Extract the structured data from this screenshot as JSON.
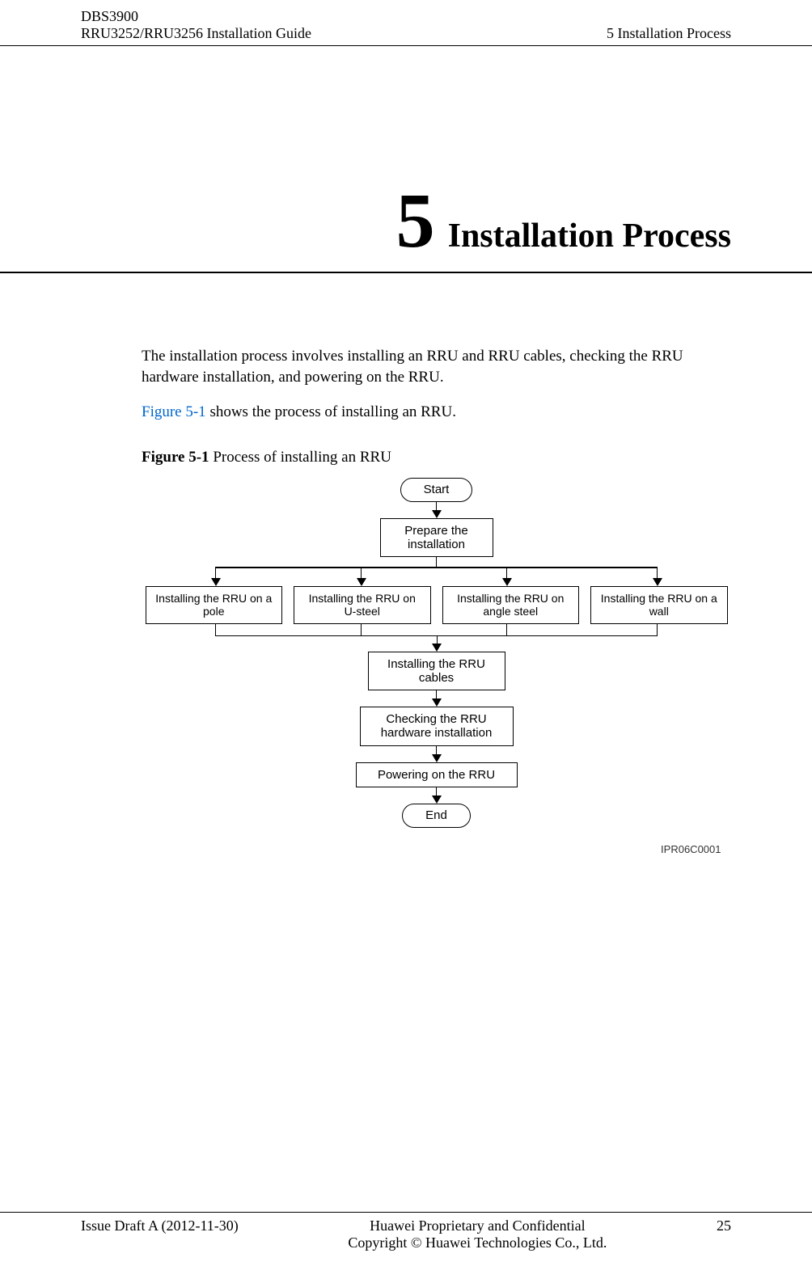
{
  "header": {
    "product": "DBS3900",
    "doc_title": "RRU3252/RRU3256 Installation Guide",
    "section": "5 Installation Process"
  },
  "chapter": {
    "number": "5",
    "title": "Installation Process"
  },
  "body": {
    "intro": "The installation process involves installing an RRU and RRU cables, checking the RRU hardware installation, and powering on the RRU.",
    "figref_link": "Figure 5-1",
    "figref_rest": " shows the process of installing an RRU.",
    "fig_label": "Figure 5-1",
    "fig_caption": " Process of installing an RRU"
  },
  "flowchart": {
    "start": "Start",
    "prepare": "Prepare the installation",
    "branches": [
      "Installing the RRU on a pole",
      "Installing the RRU on U-steel",
      "Installing the RRU on angle steel",
      "Installing the RRU on a wall"
    ],
    "cables": "Installing the RRU cables",
    "check": "Checking the RRU hardware installation",
    "power": "Powering on the RRU",
    "end": "End",
    "fig_id": "IPR06C0001"
  },
  "footer": {
    "issue": "Issue Draft A (2012-11-30)",
    "line1": "Huawei Proprietary and Confidential",
    "line2": "Copyright © Huawei Technologies Co., Ltd.",
    "page": "25"
  }
}
